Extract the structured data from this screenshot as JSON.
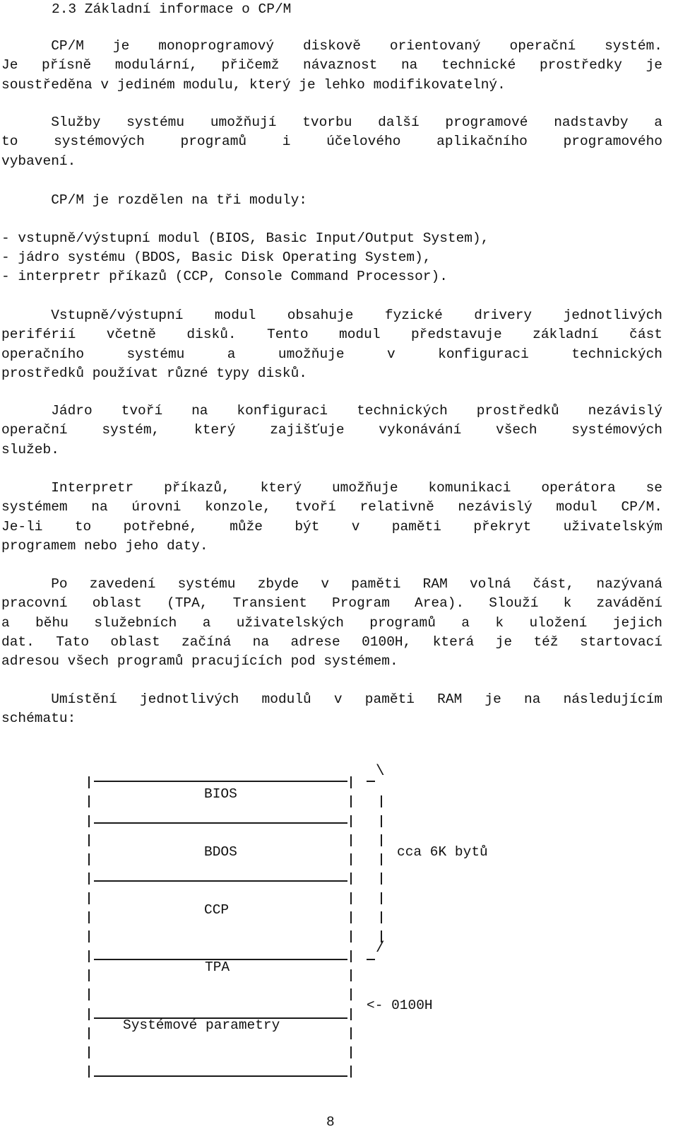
{
  "section_heading": "2.3 Základní informace o CP/M",
  "paragraphs": {
    "p1": [
      "      CP/M je monoprogramový diskově orientovaný operační  systém.",
      "Je přísně modulární, přičemž návaznost na technické prostředky je",
      "soustředěna v jediném modulu, který je lehko modifikovatelný."
    ],
    "p2": [
      "      Služby systému umožňují tvorbu další programové nadstavby  a",
      "to  systémových  programů  i  účelového  aplikačního  programového",
      "vybavení."
    ],
    "p3_intro": "      CP/M je rozdělen na tři moduly:",
    "modules_list": [
      "- vstupně/výstupní modul (BIOS, Basic Input/Output System),",
      "- jádro systému (BDOS, Basic Disk Operating System),",
      "- interpretr příkazů (CCP, Console Command Processor)."
    ],
    "p4": [
      "      Vstupně/výstupní modul obsahuje fyzické drivery jednotlivých",
      "periférií  včetně  disků. Tento modul představuje  základní  část",
      "operačního   systému   a  umožňuje  v  konfiguraci   technických",
      "prostředků používat různé typy disků."
    ],
    "p5": [
      "      Jádro tvoří na konfiguraci technických prostředků  nezávislý",
      "operační  systém,  který zajišťuje vykonávání  všech  systémových",
      "služeb."
    ],
    "p6": [
      "      Interpretr příkazů, který umožňuje komunikaci  operátora  se",
      "systémem na úrovni konzole, tvoří relativně nezávislý modul CP/M.",
      "Je-li  to  potřebné,  může  být  v  paměti  překryt  uživatelským",
      "programem nebo jeho daty."
    ],
    "p7": [
      "      Po zavedení systému zbyde v paměti RAM volná část,  nazývaná",
      "pracovní oblast (TPA, Transient Program Area). Slouží k  zavádění",
      "a  běhu  služebních a uživatelských programů a k  uložení  jejich",
      "dat. Tato oblast začíná na adrese 0100H, která je též  startovací",
      "adresou všech programů pracujících pod systémem."
    ],
    "p8": [
      "      Umístění jednotlivých modulů v paměti RAM je na následujícím",
      "schématu:"
    ]
  },
  "memory_diagram": {
    "blocks": [
      "BIOS",
      "BDOS",
      "CCP",
      "TPA",
      "Systémové parametry"
    ],
    "brace_label": "cca 6K bytů",
    "address_marker": "<- 0100H"
  },
  "page_number": "8"
}
